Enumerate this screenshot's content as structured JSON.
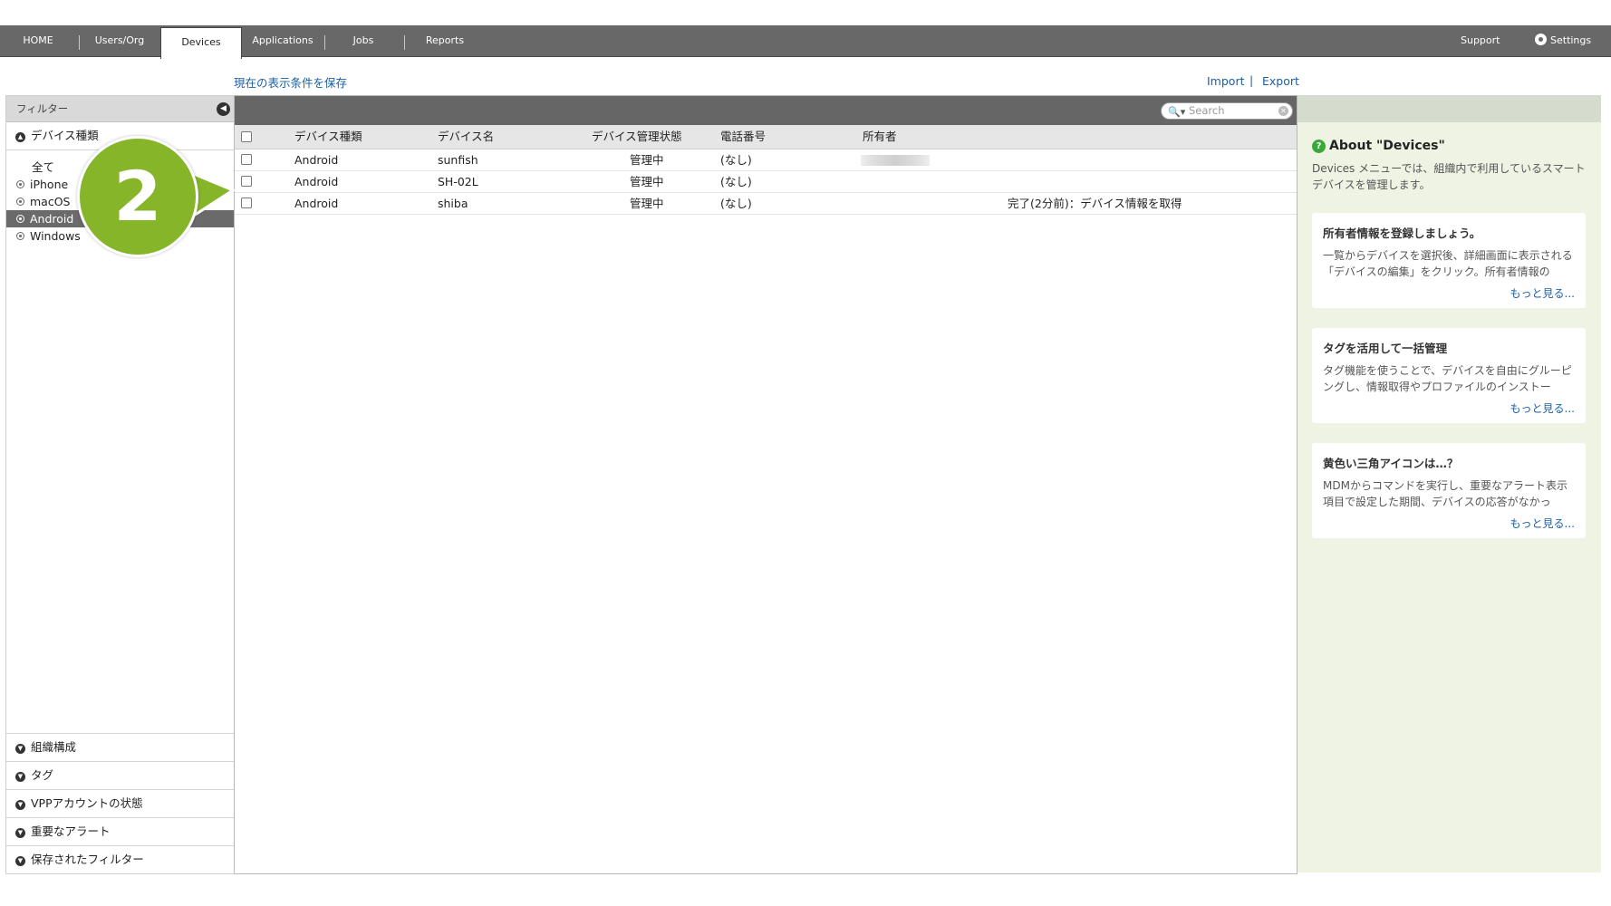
{
  "nav": {
    "tabs": [
      "HOME",
      "Users/Org",
      "Devices",
      "Applications",
      "Jobs",
      "Reports"
    ],
    "active_tab": "Devices",
    "support": "Support",
    "settings": "Settings"
  },
  "links": {
    "save_view": "現在の表示条件を保存",
    "import": "Import",
    "export": "Export",
    "separator": "|"
  },
  "filter": {
    "header": "フィルター",
    "device_type_section": "デバイス種類",
    "options": [
      "全て",
      "iPhone",
      "macOS",
      "Android",
      "Windows"
    ],
    "selected_option": "Android",
    "bottom_sections": [
      "組織構成",
      "タグ",
      "VPPアカウントの状態",
      "重要なアラート",
      "保存されたフィルター"
    ]
  },
  "table": {
    "search_placeholder": "Search",
    "columns": [
      "デバイス種類",
      "デバイス名",
      "デバイス管理状態",
      "電話番号",
      "所有者"
    ],
    "rows": [
      {
        "type": "Android",
        "name": "sunfish",
        "status": "管理中",
        "phone": "(なし)",
        "owner": "",
        "job": ""
      },
      {
        "type": "Android",
        "name": "SH-02L",
        "status": "管理中",
        "phone": "(なし)",
        "owner": "",
        "job": ""
      },
      {
        "type": "Android",
        "name": "shiba",
        "status": "管理中",
        "phone": "(なし)",
        "owner": "",
        "job": "完了(2分前)：デバイス情報を取得"
      }
    ]
  },
  "info": {
    "title": "About \"Devices\"",
    "description": "Devices メニューでは、組織内で利用しているスマートデバイスを管理します。",
    "cards": [
      {
        "title": "所有者情報を登録しましょう。",
        "body": "一覧からデバイスを選択後、詳細画面に表示される「デバイスの編集」をクリック。所有者情報の",
        "more": "もっと見る..."
      },
      {
        "title": "タグを活用して一括管理",
        "body": "タグ機能を使うことで、デバイスを自由にグルーピングし、情報取得やプロファイルのインストー",
        "more": "もっと見る..."
      },
      {
        "title": "黄色い三角アイコンは…？",
        "body": "MDMからコマンドを実行し、重要なアラート表示項目で設定した期間、デバイスの応答がなかっ",
        "more": "もっと見る..."
      }
    ]
  },
  "callout": {
    "number": "2",
    "color": "#86b52a"
  },
  "colors": {
    "nav_bg": "#686868",
    "link": "#1a5fa8",
    "selected_bg": "#6a6a6a",
    "info_bg": "#eef3e4"
  }
}
